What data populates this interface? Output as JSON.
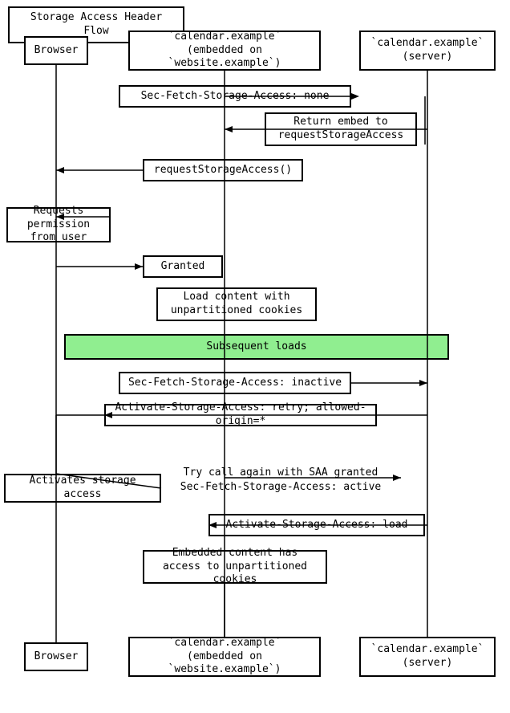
{
  "title": "Storage Access Header Flow",
  "boxes": {
    "title": "Storage Access Header Flow",
    "browser_top": "Browser",
    "embed_top": "`calendar.example`\n(embedded on `website.example`)",
    "server_top": "`calendar.example`\n(server)",
    "sec_fetch_none": "Sec-Fetch-Storage-Access: none",
    "return_embed": "Return embed to\nrequestStorageAccess",
    "request_storage": "requestStorageAccess()",
    "requests_permission": "Requests permission\nfrom user",
    "granted": "Granted",
    "load_content": "Load content with\nunpartitioned cookies",
    "subsequent_loads": "Subsequent loads",
    "sec_fetch_inactive": "Sec-Fetch-Storage-Access: inactive",
    "activate_retry": "Activate-Storage-Access: retry; allowed-origin=*",
    "activates_storage": "Activates storage access",
    "try_call_again": "Try call again with SAA granted\nSec-Fetch-Storage-Access: active",
    "activate_load": "Activate-Storage-Access: load",
    "embedded_content": "Embedded content has\naccess to unpartitioned cookies",
    "browser_bottom": "Browser",
    "embed_bottom": "`calendar.example`\n(embedded on `website.example`)",
    "server_bottom": "`calendar.example`\n(server)"
  }
}
